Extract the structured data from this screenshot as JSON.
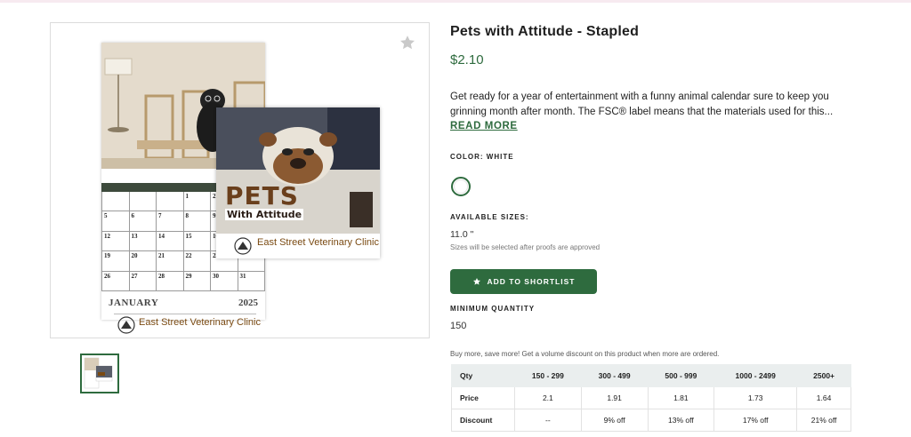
{
  "product": {
    "title": "Pets with Attitude - Stapled",
    "price": "$2.10",
    "description": "Get ready for a year of entertainment with a funny animal calendar sure to keep you grinning month after month. The FSC® label means that the materials used for this...",
    "read_more": "READ MORE",
    "color_label": "COLOR: WHITE",
    "sizes_label": "AVAILABLE SIZES:",
    "size_value": "11.0 \"",
    "sizes_note": "Sizes will be selected after proofs are approved",
    "shortlist_button": "ADD TO SHORTLIST",
    "min_qty_label": "MINIMUM QUANTITY",
    "min_qty_value": "150",
    "bulk_note": "Buy more, save more! Get a volume discount on this product when more are ordered."
  },
  "pricing_table": {
    "headers": [
      "Qty",
      "150 - 299",
      "300 - 499",
      "500 - 999",
      "1000 - 2499",
      "2500+"
    ],
    "rows": [
      [
        "Price",
        "2.1",
        "1.91",
        "1.81",
        "1.73",
        "1.64"
      ],
      [
        "Discount",
        "--",
        "9% off",
        "13% off",
        "17% off",
        "21% off"
      ]
    ]
  },
  "image": {
    "month": "JANUARY",
    "year": "2025",
    "clinic": "East Street Veterinary Clinic",
    "brand_line1": "PETS",
    "brand_line2": "With Attitude",
    "days": [
      "5",
      "6",
      "7",
      "8",
      "9",
      "12",
      "13",
      "14",
      "15",
      "16",
      "19",
      "20",
      "21",
      "22",
      "23",
      "26",
      "27",
      "28",
      "29",
      "30",
      "31"
    ],
    "first_row_days": [
      "1",
      "2"
    ]
  },
  "colors": {
    "accent": "#2e6b3e"
  },
  "icons": {
    "favorite": "star-outline-icon",
    "button": "star-icon"
  }
}
